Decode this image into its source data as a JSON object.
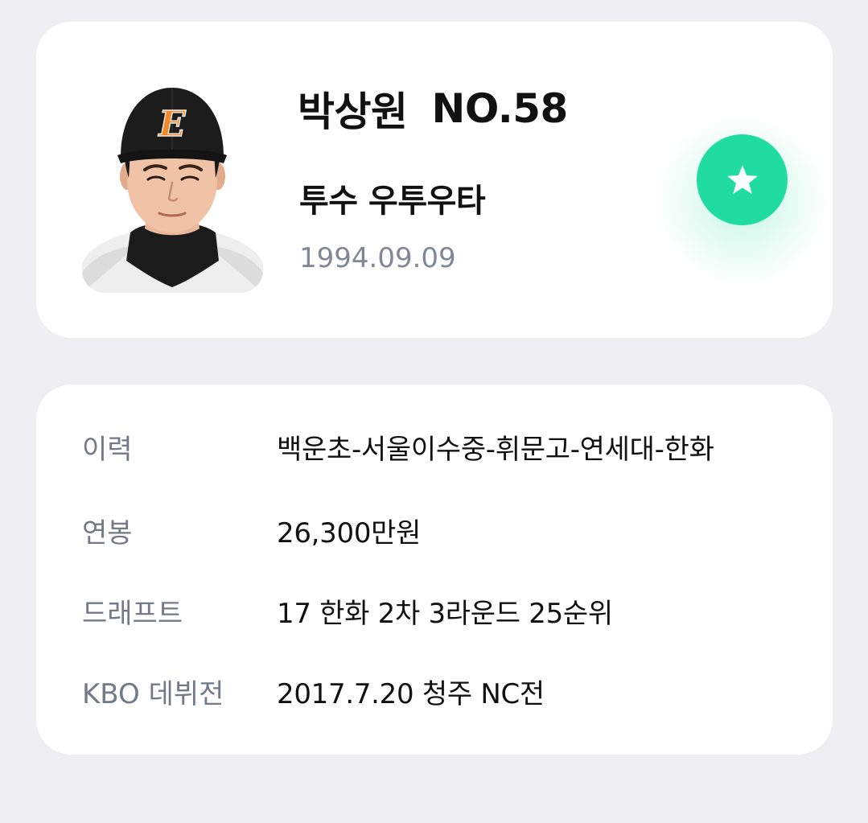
{
  "player": {
    "name": "박상원",
    "number": "NO.58",
    "position": "투수 우투우타",
    "birth_date": "1994.09.09",
    "photo_cap_letter": "E"
  },
  "favorite": {
    "icon": "star-icon",
    "color": "#20dca0"
  },
  "info": [
    {
      "label": "이력",
      "value": "백운초-서울이수중-휘문고-연세대-한화"
    },
    {
      "label": "연봉",
      "value": "26,300만원"
    },
    {
      "label": "드래프트",
      "value": "17 한화 2차 3라운드 25순위"
    },
    {
      "label": "KBO 데뷔전",
      "value": "2017.7.20 청주 NC전"
    }
  ],
  "colors": {
    "background": "#efeff3",
    "card": "#ffffff",
    "label": "#707a88",
    "value": "#111111",
    "birth": "#7f8896",
    "accent": "#20dca0",
    "cap_logo": "#f08a2c"
  }
}
